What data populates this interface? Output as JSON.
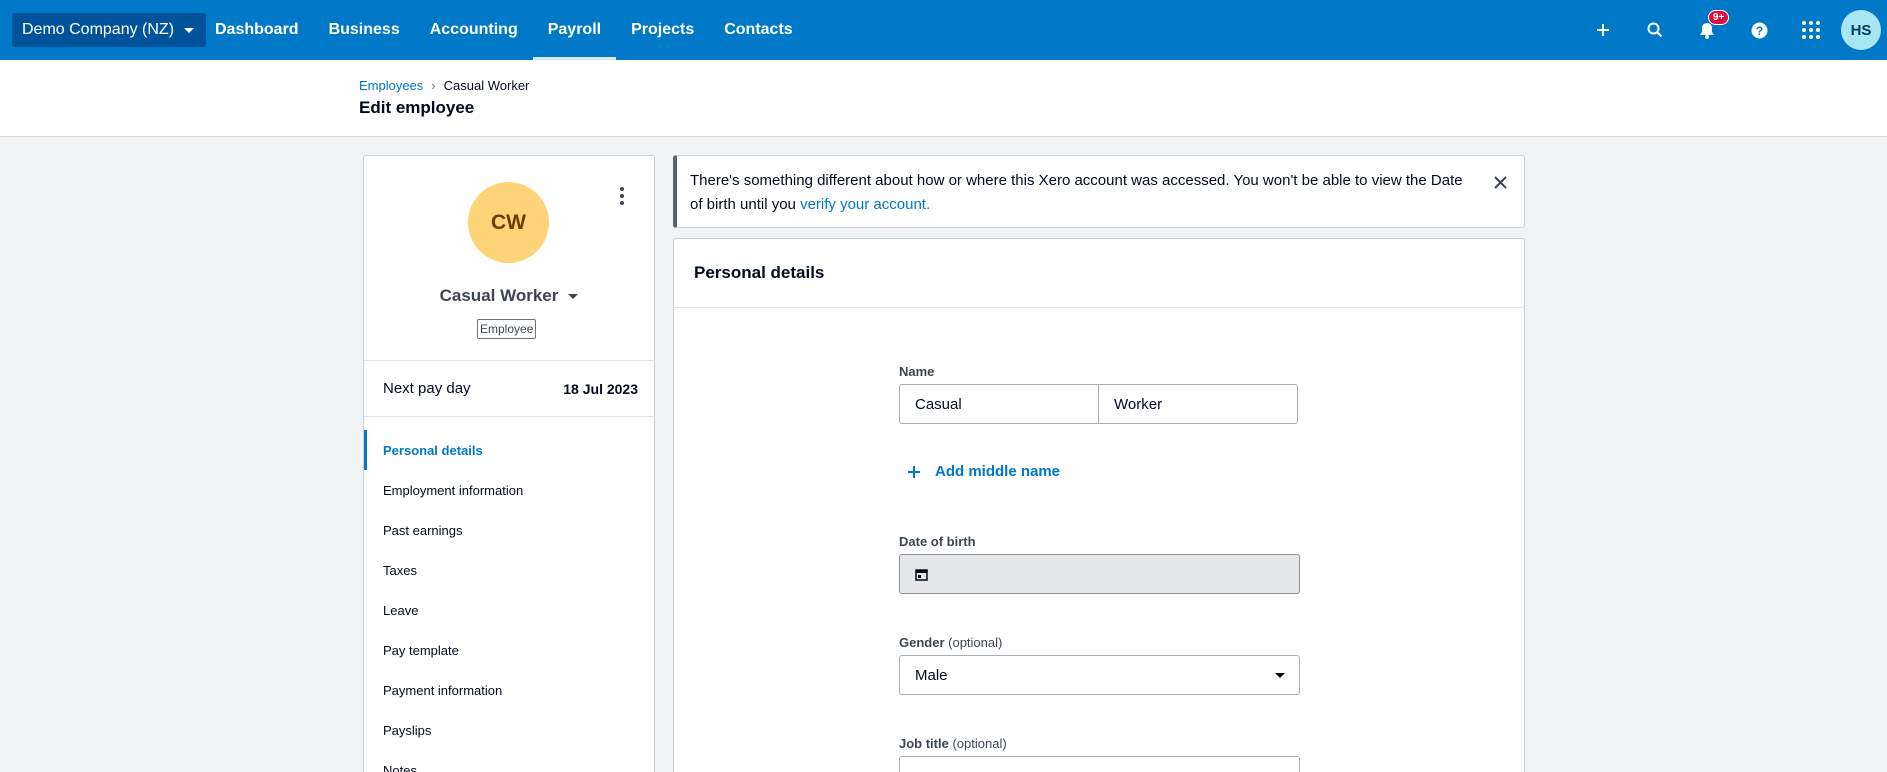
{
  "topbar": {
    "org_name": "Demo Company (NZ)",
    "nav": [
      "Dashboard",
      "Business",
      "Accounting",
      "Payroll",
      "Projects",
      "Contacts"
    ],
    "active_nav": "Payroll",
    "notification_count": "9+",
    "user_initials": "HS",
    "brand_color": "#0078c8"
  },
  "header": {
    "breadcrumb_parent": "Employees",
    "breadcrumb_separator": "›",
    "breadcrumb_current": "Casual Worker",
    "title": "Edit employee"
  },
  "employee": {
    "initials": "CW",
    "name": "Casual Worker",
    "role": "Employee",
    "next_pay_label": "Next pay day",
    "next_pay_value": "18 Jul 2023"
  },
  "side_nav": [
    "Personal details",
    "Employment information",
    "Past earnings",
    "Taxes",
    "Leave",
    "Pay template",
    "Payment information",
    "Payslips",
    "Notes"
  ],
  "alert": {
    "text": "There's something different about how or where this Xero account was accessed. You won't be able to view the Date of birth until you ",
    "link": "verify your account."
  },
  "personal_details": {
    "title": "Personal details",
    "name_label": "Name",
    "first_name": "Casual",
    "last_name": "Worker",
    "add_middle_name": "Add middle name",
    "dob_label": "Date of birth",
    "gender_label": "Gender",
    "optional": "(optional)",
    "gender_value": "Male",
    "job_title_label": "Job title"
  }
}
